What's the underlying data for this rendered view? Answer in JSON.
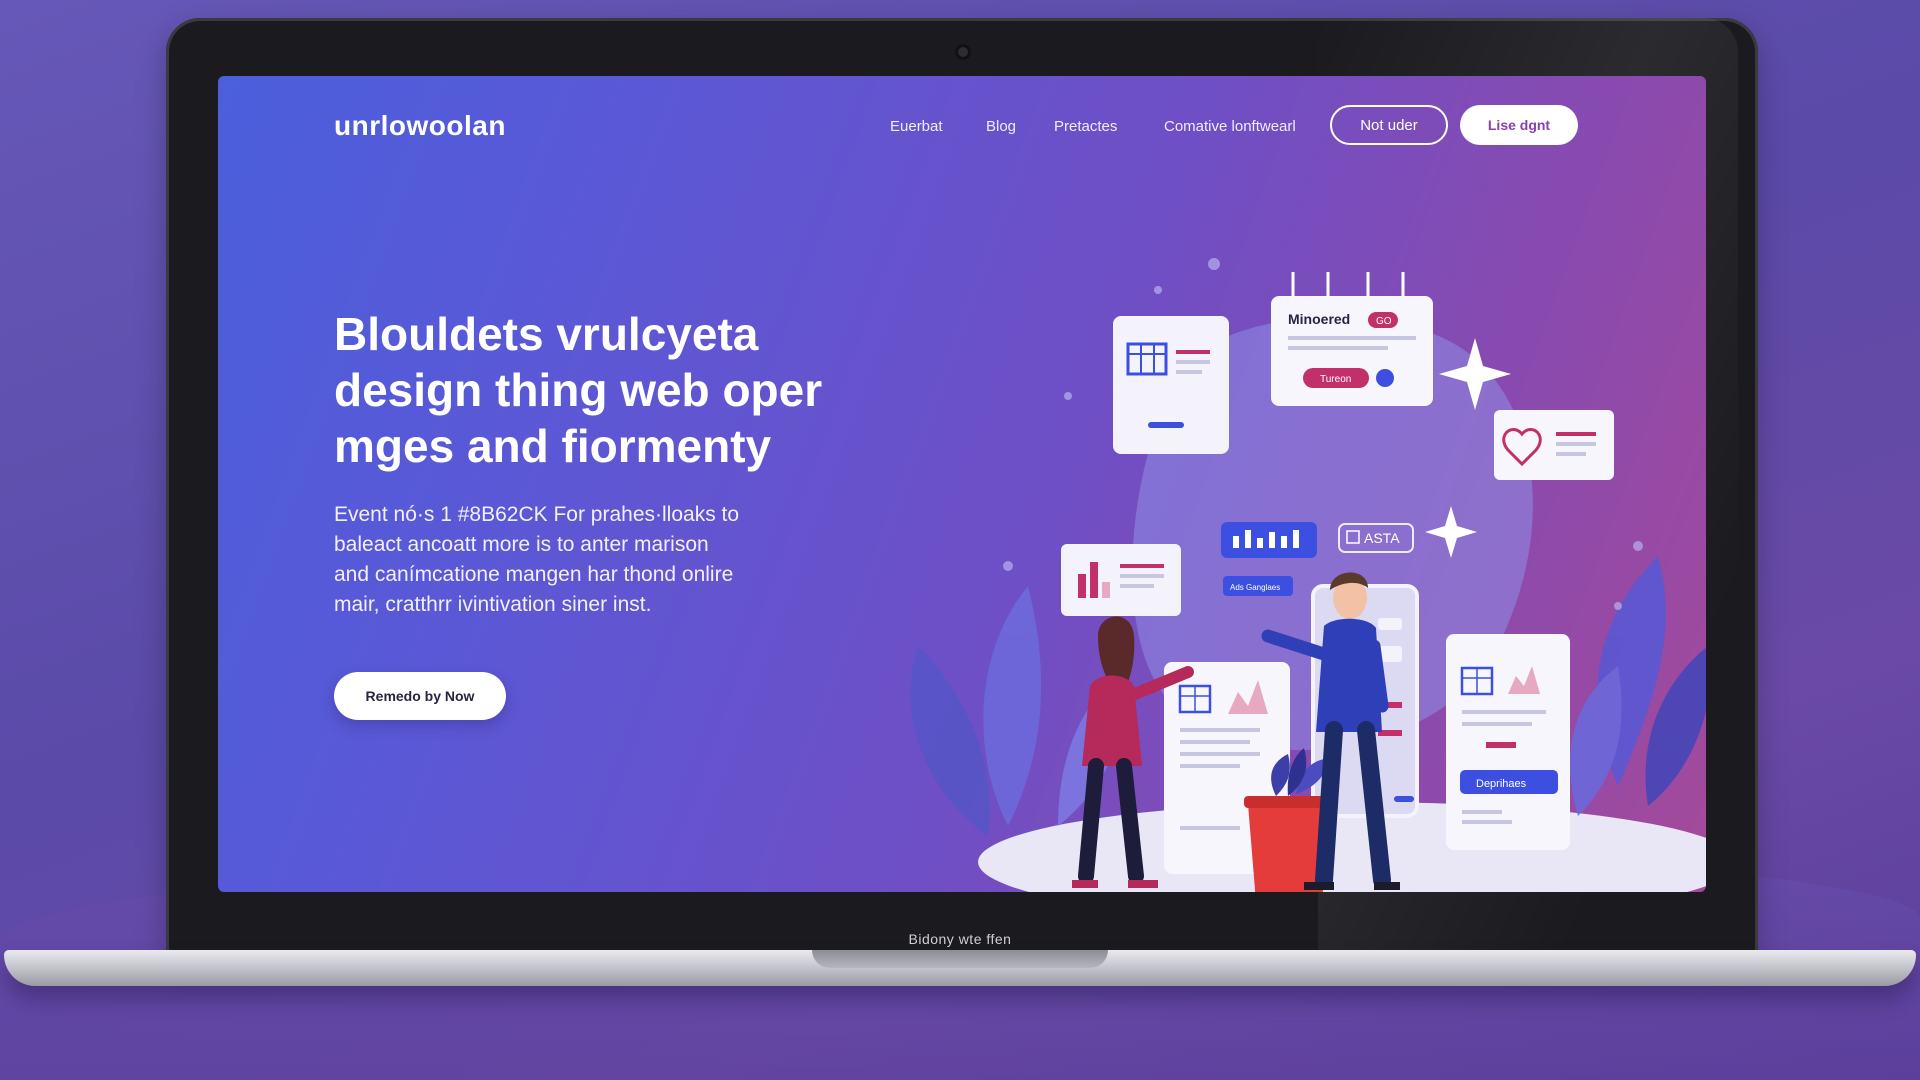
{
  "laptop": {
    "chin_label": "Bidony wte ffen"
  },
  "nav": {
    "logo": "unrlowoolan",
    "links": [
      "Euerbat",
      "Blog",
      "Pretactes",
      "Comative lonftwearl"
    ],
    "outline_button": "Not uder",
    "solid_button": "Lise dgnt"
  },
  "hero": {
    "title_lines": [
      "Blouldets vrulcyeta",
      "design thing web oper",
      "mges and fiormenty"
    ],
    "description_lines": [
      "Event nó·s 1 #8B62CK For prahes·lloaks to",
      "baleact ancoatt more is to anter marison",
      "and canímcatione mangen har thond onlire",
      "mair, cratthrr ivintivation siner inst."
    ],
    "cta_label": "Remedo by Now"
  },
  "illustration": {
    "card_title": "Minoered",
    "card_badge": "GO",
    "card_button": "Tureon",
    "asta_label": "ASTA",
    "small_tag": "Ads Ganglaes",
    "dep_button": "Deprihaes"
  },
  "colors": {
    "screen_gradient": [
      "#4b5fdc",
      "#6e4fc6",
      "#a44a9a"
    ],
    "accent_pink": "#c2306a",
    "accent_blue": "#3d4fe0"
  }
}
